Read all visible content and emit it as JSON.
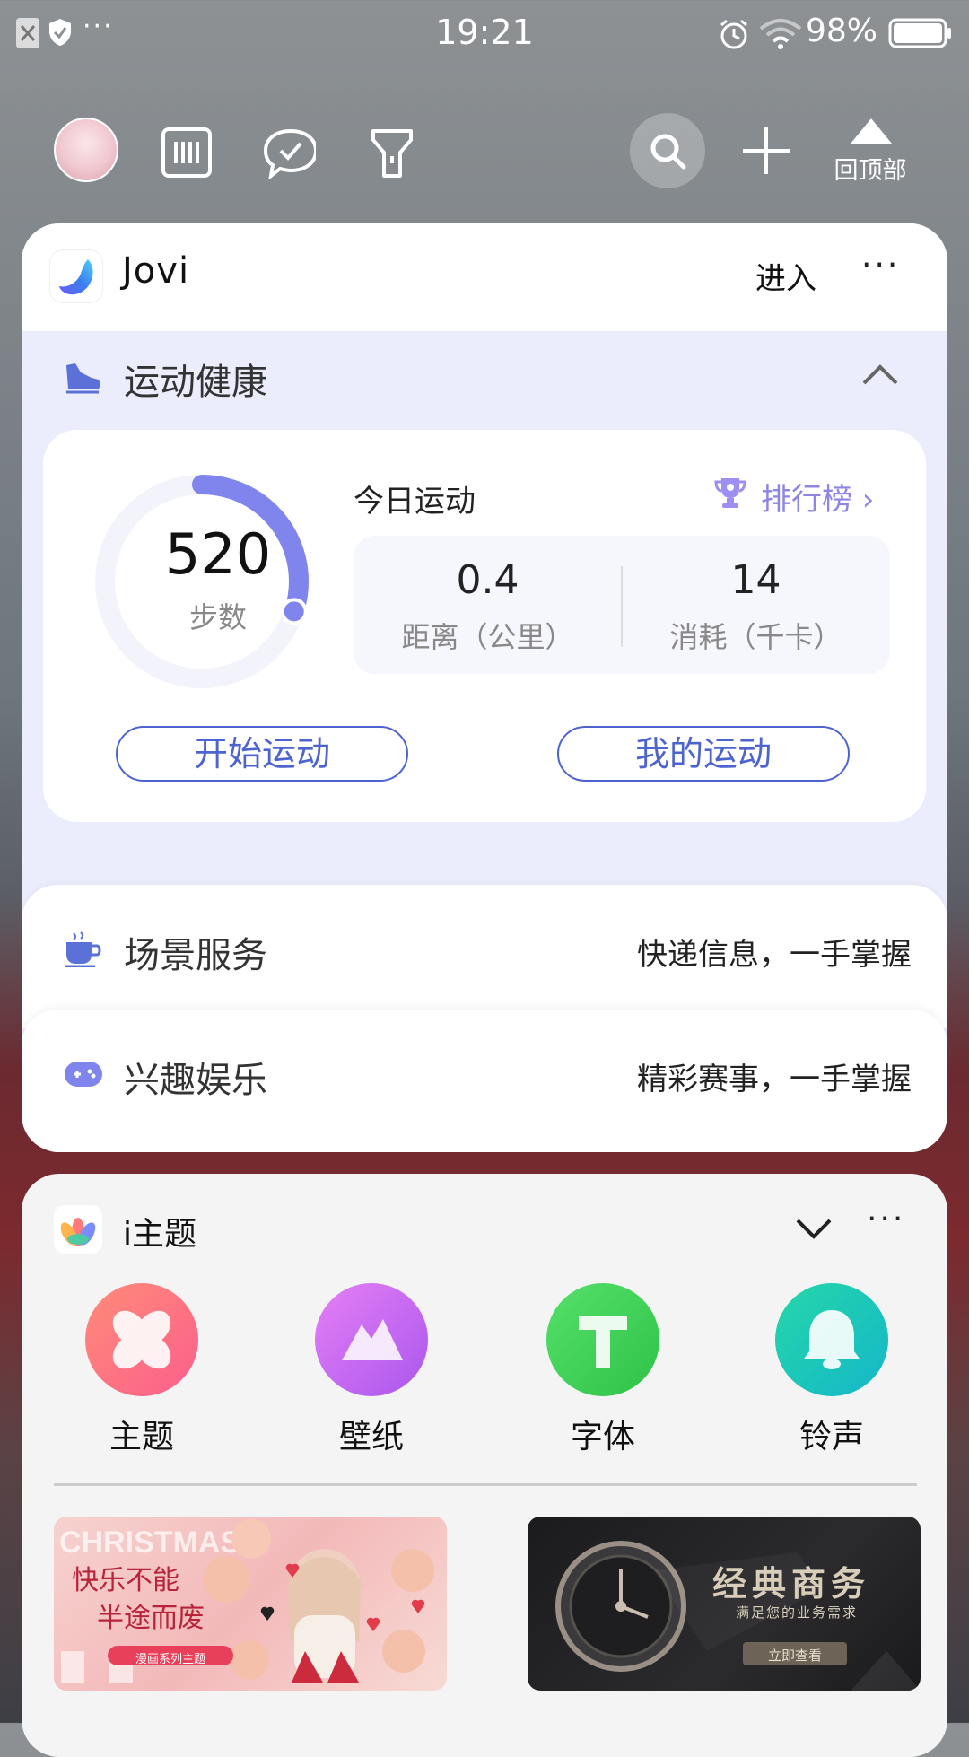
{
  "status_bar": {
    "time": "19:21",
    "battery_pct": "98%"
  },
  "toolbar": {
    "back_to_top_label": "回顶部"
  },
  "jovi": {
    "title": "Jovi",
    "enter_label": "进入",
    "more": "···",
    "fitness": {
      "section_label": "运动健康",
      "steps": "520",
      "steps_label": "步数",
      "steps_progress": 0.3,
      "today_label": "今日运动",
      "ranking_label": "排行榜 ›",
      "distance_value": "0.4",
      "distance_label": "距离（公里）",
      "calories_value": "14",
      "calories_label": "消耗（千卡）",
      "start_button": "开始运动",
      "my_button": "我的运动"
    },
    "scene": {
      "label": "场景服务",
      "desc": "快递信息，一手掌握"
    },
    "fun": {
      "label": "兴趣娱乐",
      "desc": "精彩赛事，一手掌握"
    }
  },
  "itheme": {
    "title": "i主题",
    "more": "···",
    "items": [
      {
        "label": "主题",
        "icon": "theme-icon",
        "color": "#fb6f7c"
      },
      {
        "label": "壁纸",
        "icon": "wallpaper-icon",
        "color": "#c66ef0"
      },
      {
        "label": "字体",
        "icon": "font-icon",
        "color": "#3ccf4e"
      },
      {
        "label": "铃声",
        "icon": "ringtone-icon",
        "color": "#18c7b7"
      }
    ],
    "banners": [
      {
        "line1": "快乐不能",
        "line2": "半途而废",
        "tag": "漫画系列主题"
      },
      {
        "title": "经典商务",
        "subtitle": "满足您的业务需求",
        "button": "立即查看"
      }
    ]
  }
}
